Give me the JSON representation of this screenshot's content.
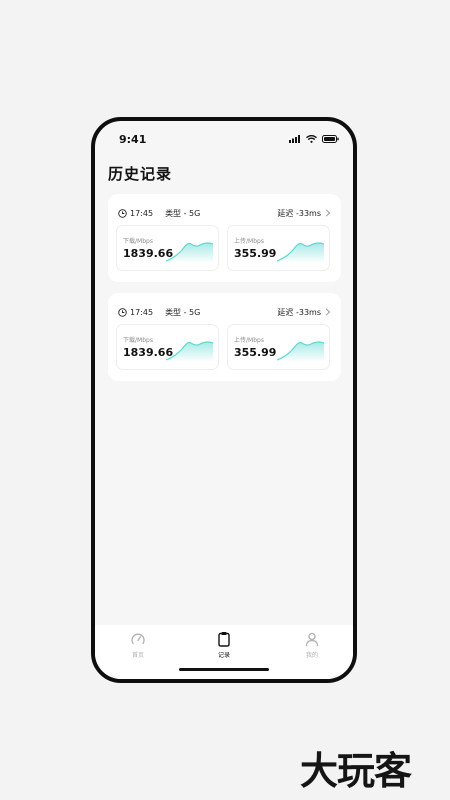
{
  "status_bar": {
    "time": "9:41"
  },
  "header": {
    "title": "历史记录"
  },
  "records": [
    {
      "time": "17:45",
      "type": "类型 - 5G",
      "latency": "延迟 -33ms",
      "download": {
        "label": "下载/Mbps",
        "value": "1839.66"
      },
      "upload": {
        "label": "上传/Mbps",
        "value": "355.99"
      }
    },
    {
      "time": "17:45",
      "type": "类型 - 5G",
      "latency": "延迟 -33ms",
      "download": {
        "label": "下载/Mbps",
        "value": "1839.66"
      },
      "upload": {
        "label": "上传/Mbps",
        "value": "355.99"
      }
    }
  ],
  "tabbar": {
    "tabs": [
      {
        "label": "首页",
        "icon": "speedometer-icon",
        "active": false
      },
      {
        "label": "记录",
        "icon": "clipboard-icon",
        "active": true
      },
      {
        "label": "我的",
        "icon": "user-icon",
        "active": false
      }
    ]
  },
  "watermark": {
    "text": "大玩客"
  },
  "colors": {
    "accent": "#5fd8d2",
    "text": "#111111",
    "muted": "#8c8c8c"
  }
}
